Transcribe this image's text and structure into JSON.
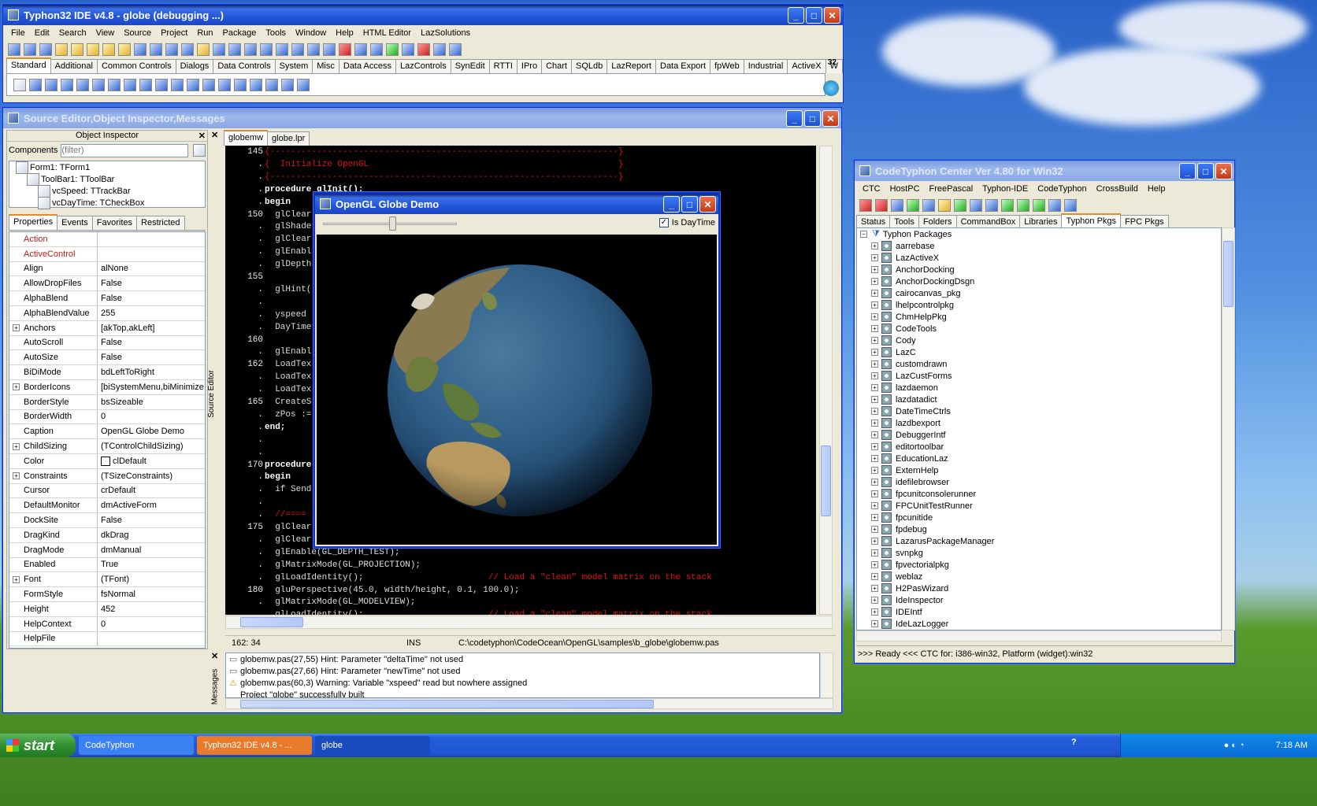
{
  "main_window": {
    "title": "Typhon32 IDE v4.8 - globe (debugging ...)",
    "menu": [
      "File",
      "Edit",
      "Search",
      "View",
      "Source",
      "Project",
      "Run",
      "Package",
      "Tools",
      "Window",
      "Help",
      "HTML Editor",
      "LazSolutions"
    ],
    "palette_tabs": [
      "Standard",
      "Additional",
      "Common Controls",
      "Dialogs",
      "Data Controls",
      "System",
      "Misc",
      "Data Access",
      "LazControls",
      "SynEdit",
      "RTTI",
      "IPro",
      "Chart",
      "SQLdb",
      "LazReport",
      "Data Export",
      "fpWeb",
      "Industrial",
      "ActiveX",
      "W"
    ],
    "scale_label": "32"
  },
  "editor_window": {
    "title": "Source Editor,Object Inspector,Messages"
  },
  "object_inspector": {
    "title": "Object Inspector",
    "components_label": "Components",
    "filter_placeholder": "(filter)",
    "tree": [
      "Form1: TForm1",
      "ToolBar1: TToolBar",
      "vcSpeed: TTrackBar",
      "vcDayTime: TCheckBox"
    ],
    "tabs": [
      "Properties",
      "Events",
      "Favorites",
      "Restricted"
    ],
    "properties": [
      [
        "Action",
        ""
      ],
      [
        "ActiveControl",
        ""
      ],
      [
        "Align",
        "alNone"
      ],
      [
        "AllowDropFiles",
        "False"
      ],
      [
        "AlphaBlend",
        "False"
      ],
      [
        "AlphaBlendValue",
        "255"
      ],
      [
        "Anchors",
        "[akTop,akLeft]"
      ],
      [
        "AutoScroll",
        "False"
      ],
      [
        "AutoSize",
        "False"
      ],
      [
        "BiDiMode",
        "bdLeftToRight"
      ],
      [
        "BorderIcons",
        "[biSystemMenu,biMinimize"
      ],
      [
        "BorderStyle",
        "bsSizeable"
      ],
      [
        "BorderWidth",
        "0"
      ],
      [
        "Caption",
        "OpenGL Globe Demo"
      ],
      [
        "ChildSizing",
        "(TControlChildSizing)"
      ],
      [
        "Color",
        "clDefault"
      ],
      [
        "Constraints",
        "(TSizeConstraints)"
      ],
      [
        "Cursor",
        "crDefault"
      ],
      [
        "DefaultMonitor",
        "dmActiveForm"
      ],
      [
        "DockSite",
        "False"
      ],
      [
        "DragKind",
        "dkDrag"
      ],
      [
        "DragMode",
        "dmManual"
      ],
      [
        "Enabled",
        "True"
      ],
      [
        "Font",
        "(TFont)"
      ],
      [
        "FormStyle",
        "fsNormal"
      ],
      [
        "Height",
        "452"
      ],
      [
        "HelpContext",
        "0"
      ],
      [
        "HelpFile",
        ""
      ]
    ]
  },
  "source_editor": {
    "tabs": [
      "globemw",
      "globe.lpr"
    ],
    "side_label": "Source Editor",
    "lines": [
      {
        "n": "145",
        "t": "{-------------------------------------------------------------------}",
        "c": "cm"
      },
      {
        "n": ".",
        "t": "{  Initialize OpenGL                                                }",
        "c": "cm"
      },
      {
        "n": ".",
        "t": "{-------------------------------------------------------------------}",
        "c": "cm"
      },
      {
        "n": ".",
        "t": "procedure glInit();",
        "c": "kw"
      },
      {
        "n": ".",
        "t": "begin",
        "c": "kw"
      },
      {
        "n": "150",
        "t": "  glClear",
        "c": ""
      },
      {
        "n": ".",
        "t": "  glShade",
        "c": ""
      },
      {
        "n": ".",
        "t": "  glClear",
        "c": ""
      },
      {
        "n": ".",
        "t": "  glEnabl",
        "c": ""
      },
      {
        "n": ".",
        "t": "  glDepth",
        "c": ""
      },
      {
        "n": "155",
        "t": "",
        "c": ""
      },
      {
        "n": ".",
        "t": "  glHint(                                                    tions",
        "c": "mix"
      },
      {
        "n": ".",
        "t": "",
        "c": ""
      },
      {
        "n": ".",
        "t": "  yspeed",
        "c": ""
      },
      {
        "n": ".",
        "t": "  DayTime",
        "c": ""
      },
      {
        "n": "160",
        "t": "",
        "c": ""
      },
      {
        "n": ".",
        "t": "  glEnabl",
        "c": ""
      },
      {
        "n": "162",
        "t": "  LoadTex",
        "c": ""
      },
      {
        "n": ".",
        "t": "  LoadTex",
        "c": ""
      },
      {
        "n": ".",
        "t": "  LoadTex",
        "c": ""
      },
      {
        "n": "165",
        "t": "  CreateS",
        "c": ""
      },
      {
        "n": ".",
        "t": "  zPos :=",
        "c": ""
      },
      {
        "n": ".",
        "t": "end;",
        "c": "kw"
      },
      {
        "n": ".",
        "t": "",
        "c": ""
      },
      {
        "n": ".",
        "t": "",
        "c": ""
      },
      {
        "n": "170",
        "t": "procedure",
        "c": "kw"
      },
      {
        "n": ".",
        "t": "begin",
        "c": "kw"
      },
      {
        "n": ".",
        "t": "  if Send",
        "c": ""
      },
      {
        "n": ".",
        "t": "",
        "c": ""
      },
      {
        "n": ".",
        "t": "  //====                                                     ============",
        "c": "cm"
      },
      {
        "n": "175",
        "t": "  glClear                                                    or scene",
        "c": "mix"
      },
      {
        "n": ".",
        "t": "  glClear",
        "c": ""
      },
      {
        "n": ".",
        "t": "  glEnable(GL_DEPTH_TEST);",
        "c": ""
      },
      {
        "n": ".",
        "t": "  glMatrixMode(GL_PROJECTION);",
        "c": ""
      },
      {
        "n": ".",
        "t": "  glLoadIdentity();                        // Load a \"clean\" model matrix on the stack",
        "c": "mix2"
      },
      {
        "n": "180",
        "t": "  gluPerspective(45.0, width/height, 0.1, 100.0);",
        "c": "nums"
      },
      {
        "n": ".",
        "t": "  glMatrixMode(GL_MODELVIEW);",
        "c": ""
      },
      {
        "n": ".",
        "t": "  glLoadIdentity();                        // Load a \"clean\" model matrix on the stack",
        "c": "mix2"
      }
    ],
    "status": {
      "pos": "162: 34",
      "mode": "INS",
      "file": "C:\\codetyphon\\CodeOcean\\OpenGL\\samples\\b_globe\\globemw.pas"
    }
  },
  "messages": {
    "side_label": "Messages",
    "items": [
      {
        "icon": "hint",
        "text": "globemw.pas(27,55) Hint: Parameter \"deltaTime\" not used"
      },
      {
        "icon": "hint",
        "text": "globemw.pas(27,66) Hint: Parameter \"newTime\" not used"
      },
      {
        "icon": "warning",
        "text": "globemw.pas(60,3) Warning: Variable \"xspeed\" read but nowhere assigned"
      },
      {
        "icon": "none",
        "text": "Project \"globe\" successfully built"
      }
    ]
  },
  "globe_window": {
    "title": "OpenGL Globe Demo",
    "checkbox_label": "Is DayTime",
    "checked": true,
    "slider_fraction": 0.52
  },
  "ctc_window": {
    "title": "CodeTyphon Center Ver 4.80 for Win32",
    "menu": [
      "CTC",
      "HostPC",
      "FreePascal",
      "Typhon-IDE",
      "CodeTyphon",
      "CrossBuild",
      "Help"
    ],
    "tabs": [
      "Status",
      "Tools",
      "Folders",
      "CommandBox",
      "Libraries",
      "Typhon Pkgs",
      "FPC Pkgs"
    ],
    "root": "Typhon Packages",
    "packages": [
      "aarrebase",
      "LazActiveX",
      "AnchorDocking",
      "AnchorDockingDsgn",
      "cairocanvas_pkg",
      "lhelpcontrolpkg",
      "ChmHelpPkg",
      "CodeTools",
      "Cody",
      "LazC",
      "customdrawn",
      "LazCustForms",
      "lazdaemon",
      "lazdatadict",
      "DateTimeCtrls",
      "lazdbexport",
      "DebuggerIntf",
      "editortoolbar",
      "EducationLaz",
      "ExternHelp",
      "idefilebrowser",
      "fpcunitconsolerunner",
      "FPCUnitTestRunner",
      "fpcunitide",
      "fpdebug",
      "LazarusPackageManager",
      "svnpkg",
      "fpvectorialpkg",
      "weblaz",
      "H2PasWizard",
      "IdeInspector",
      "IDEIntf",
      "IdeLazLogger"
    ],
    "status": ">>> Ready <<<  CTC for: i386-win32, Platform (widget):win32"
  },
  "taskbar": {
    "start": "start",
    "tasks": [
      "CodeTyphon",
      "Typhon32 IDE v4.8 - ...",
      "globe"
    ],
    "clock": "7:18 AM"
  }
}
